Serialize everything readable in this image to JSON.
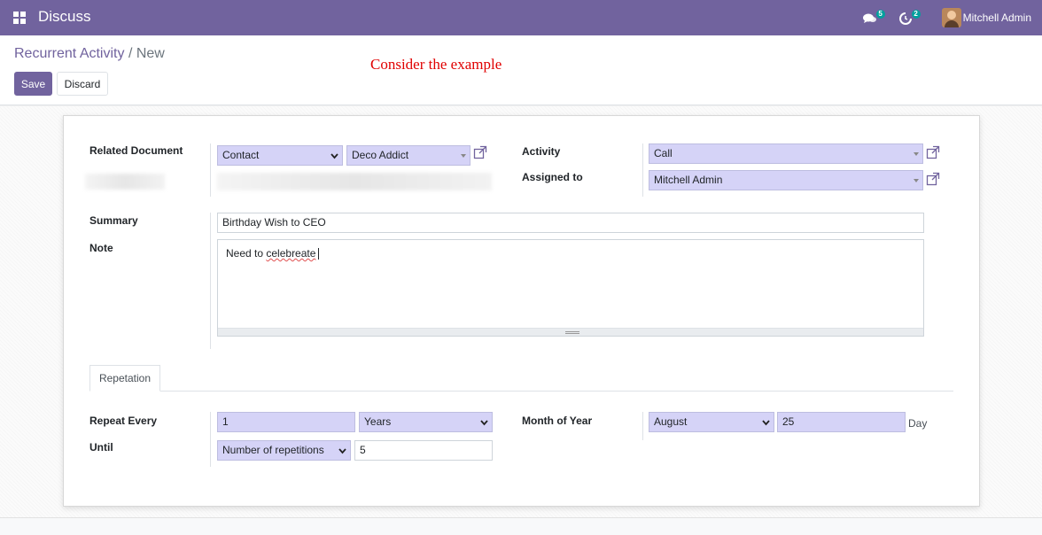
{
  "navbar": {
    "app_title": "Discuss",
    "messages_count": "5",
    "activities_count": "2",
    "user_name": "Mitchell Admin"
  },
  "breadcrumb": {
    "parent": "Recurrent Activity",
    "separator": "/",
    "current": "New"
  },
  "toolbar": {
    "save_label": "Save",
    "discard_label": "Discard"
  },
  "annotation": "Consider the example",
  "form": {
    "related_document_label": "Related Document",
    "related_model": "Contact",
    "related_record": "Deco Addict",
    "activity_label": "Activity",
    "activity_value": "Call",
    "assigned_to_label": "Assigned to",
    "assigned_to_value": "Mitchell Admin",
    "summary_label": "Summary",
    "summary_value": "Birthday Wish to CEO",
    "note_label": "Note",
    "note_prefix": "Need to ",
    "note_misspelled": "celebreate"
  },
  "tabs": {
    "repetation_label": "Repetation"
  },
  "repetition": {
    "repeat_every_label": "Repeat Every",
    "repeat_every_value": "1",
    "repeat_unit": "Years",
    "until_label": "Until",
    "until_value": "Number of repetitions",
    "repetitions_count": "5",
    "month_of_year_label": "Month of Year",
    "month_value": "August",
    "day_value": "25",
    "day_unit": "Day"
  },
  "colors": {
    "brand": "#71639e",
    "required_field": "#d5d3f7",
    "annotation": "#e00000",
    "badge": "#00a09d"
  }
}
